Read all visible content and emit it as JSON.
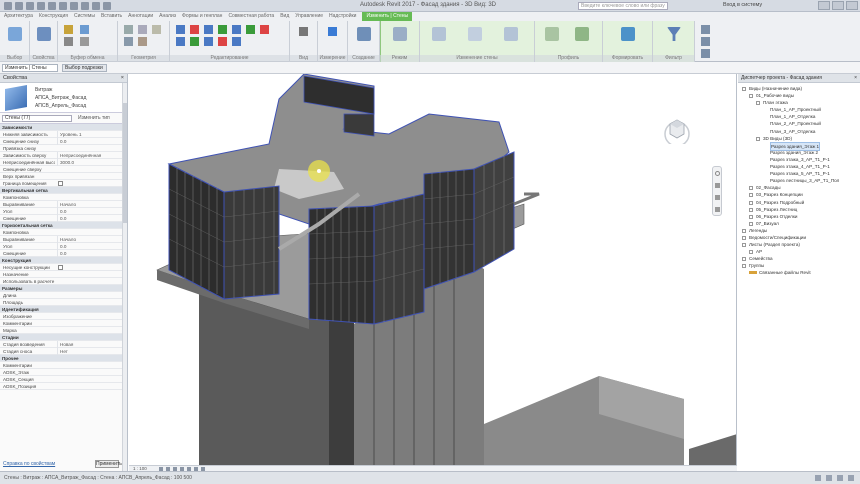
{
  "titlebar": {
    "title": "Autodesk Revit 2017 -   Фасад здания - 3D Вид: 3D",
    "search_placeholder": "Введите ключевое слово или фразу",
    "user": "Вход в систему"
  },
  "ribbon": {
    "tabs": [
      "Архитектура",
      "Конструкция",
      "Системы",
      "Вставить",
      "Аннотации",
      "Анализ",
      "Формы и генплан",
      "Совместная работа",
      "Вид",
      "Управление",
      "Надстройки",
      "Изменить | Стены"
    ],
    "active_tab": "Изменить | Стены",
    "panels": [
      "Выбор",
      "Свойства",
      "Буфер обмена",
      "Геометрия",
      "Редактирование",
      "Вид",
      "Измерение",
      "Создание",
      "Режим",
      "Изменение стены",
      "Профиль",
      "Формировать",
      "Фильтр"
    ],
    "tool_labels": {
      "modify": "Изменить",
      "edit_profile": "Редактировать профиль",
      "attach": "Прикрепить верх/низ",
      "detach": "Открепить верх/низ",
      "filter": "Фильтр",
      "create": "Создать"
    }
  },
  "options_bar": {
    "selector": "Изменить | Стены",
    "mode": "Выбор подрезки"
  },
  "properties": {
    "header": "Свойства",
    "family": "Витраж",
    "type_name": "АПСА_Витраж_Фасад",
    "type_sub": "АПСВ_Апрель_Фасад",
    "filter": "Стены (77)",
    "edit_type": "Изменить тип",
    "rows": [
      {
        "kind": "group",
        "label": "Зависимости"
      },
      {
        "kind": "row",
        "key": "Нижняя зависимость",
        "value": "Уровень 1"
      },
      {
        "kind": "row",
        "key": "Смещение снизу",
        "value": "0.0"
      },
      {
        "kind": "row",
        "key": "Привязка снизу",
        "value": ""
      },
      {
        "kind": "row",
        "key": "Зависимость сверху",
        "value": "Неприсоединённая"
      },
      {
        "kind": "row",
        "key": "Неприсоединённая высота",
        "value": "3000.0"
      },
      {
        "kind": "row",
        "key": "Смещение сверху",
        "value": ""
      },
      {
        "kind": "row",
        "key": "Верх привязан",
        "value": ""
      },
      {
        "kind": "check",
        "key": "Граница помещения",
        "value": ""
      },
      {
        "kind": "group",
        "label": "Вертикальная сетка"
      },
      {
        "kind": "row",
        "key": "Компоновка",
        "value": ""
      },
      {
        "kind": "row",
        "key": "Выравнивание",
        "value": "Начало"
      },
      {
        "kind": "row",
        "key": "Угол",
        "value": "0.0"
      },
      {
        "kind": "row",
        "key": "Смещение",
        "value": "0.0"
      },
      {
        "kind": "group",
        "label": "Горизонтальная сетка"
      },
      {
        "kind": "row",
        "key": "Компоновка",
        "value": ""
      },
      {
        "kind": "row",
        "key": "Выравнивание",
        "value": "Начало"
      },
      {
        "kind": "row",
        "key": "Угол",
        "value": "0.0"
      },
      {
        "kind": "row",
        "key": "Смещение",
        "value": "0.0"
      },
      {
        "kind": "group",
        "label": "Конструкция"
      },
      {
        "kind": "check",
        "key": "Несущие конструкции",
        "value": ""
      },
      {
        "kind": "row",
        "key": "Назначение",
        "value": ""
      },
      {
        "kind": "row",
        "key": "Использовать в расчете",
        "value": ""
      },
      {
        "kind": "group",
        "label": "Размеры"
      },
      {
        "kind": "row",
        "key": "Длина",
        "value": ""
      },
      {
        "kind": "row",
        "key": "Площадь",
        "value": ""
      },
      {
        "kind": "group",
        "label": "Идентификация"
      },
      {
        "kind": "row",
        "key": "Изображение",
        "value": ""
      },
      {
        "kind": "row",
        "key": "Комментарии",
        "value": ""
      },
      {
        "kind": "row",
        "key": "Марка",
        "value": ""
      },
      {
        "kind": "group",
        "label": "Стадии"
      },
      {
        "kind": "row",
        "key": "Стадия возведения",
        "value": "Новая"
      },
      {
        "kind": "row",
        "key": "Стадия сноса",
        "value": "Нет"
      },
      {
        "kind": "group",
        "label": "Прочее"
      },
      {
        "kind": "row",
        "key": "Комментарии",
        "value": ""
      },
      {
        "kind": "row",
        "key": "ADSK_Этаж",
        "value": ""
      },
      {
        "kind": "row",
        "key": "ADSK_Секция",
        "value": ""
      },
      {
        "kind": "row",
        "key": "ADSK_Позиция",
        "value": ""
      }
    ],
    "help_link": "Справка по свойствам",
    "apply": "Применить"
  },
  "browser": {
    "header": "Диспетчер проекта - Фасад здания",
    "tree": [
      {
        "level": 0,
        "label": "Виды (Назначение вида)",
        "expand": "-"
      },
      {
        "level": 1,
        "label": "01_Рабочие виды",
        "expand": "-"
      },
      {
        "level": 2,
        "label": "План этажа",
        "expand": "-"
      },
      {
        "level": 3,
        "label": "План_1_АР_Проектный",
        "expand": ""
      },
      {
        "level": 3,
        "label": "План_1_АР_Отделка",
        "expand": ""
      },
      {
        "level": 3,
        "label": "План_2_АР_Проектный",
        "expand": ""
      },
      {
        "level": 3,
        "label": "План_3_АР_Отделка",
        "expand": ""
      },
      {
        "level": 2,
        "label": "3D Виды (3D)",
        "expand": "-"
      },
      {
        "level": 3,
        "label": "Разрез здания_Этаж 1",
        "expand": "",
        "highlight": true
      },
      {
        "level": 3,
        "label": "Разрез здания_Этаж 2",
        "expand": ""
      },
      {
        "level": 3,
        "label": "Разрез этажа_3_АР_Т1_Р-1",
        "expand": ""
      },
      {
        "level": 3,
        "label": "Разрез этажа_4_АР_Т1_Р-1",
        "expand": ""
      },
      {
        "level": 3,
        "label": "Разрез этажа_5_АР_Т1_Р-1",
        "expand": ""
      },
      {
        "level": 3,
        "label": "Разрез лестницы_3_АР_Т1_Пол",
        "expand": ""
      },
      {
        "level": 1,
        "label": "02_Фасады",
        "expand": "+"
      },
      {
        "level": 1,
        "label": "03_Разрез Концепции",
        "expand": "+"
      },
      {
        "level": 1,
        "label": "04_Разрез Подробный",
        "expand": "+"
      },
      {
        "level": 1,
        "label": "05_Разрез Лестниц",
        "expand": "+"
      },
      {
        "level": 1,
        "label": "06_Разрез Отделки",
        "expand": "+"
      },
      {
        "level": 1,
        "label": "07_Визуал",
        "expand": "+"
      },
      {
        "level": 0,
        "label": "Легенды",
        "expand": "+"
      },
      {
        "level": 0,
        "label": "Ведомости/Спецификации",
        "expand": "+"
      },
      {
        "level": 0,
        "label": "Листы (Раздел проекта)",
        "expand": "+"
      },
      {
        "level": 1,
        "label": "АР",
        "expand": "+"
      },
      {
        "level": 0,
        "label": "Семейства",
        "expand": "+"
      },
      {
        "level": 0,
        "label": "Группы",
        "expand": "+"
      },
      {
        "level": 0,
        "label": "Связанные файлы Revit",
        "expand": "",
        "swatch": true
      }
    ]
  },
  "viewport": {
    "scale": "1 : 100",
    "viewcube_label": "ВИД"
  },
  "statusbar": {
    "text": "Стены : Витраж : АПСА_Витраж_Фасад : Стена : АПСВ_Апрель_Фасад : 100 500"
  },
  "colors": {
    "ribbon_context": "#66bb55",
    "selection": "#3f52b4",
    "roof": "#8e8e8e",
    "glass": "#2c2c2c",
    "tower": "#5d5d5d"
  }
}
